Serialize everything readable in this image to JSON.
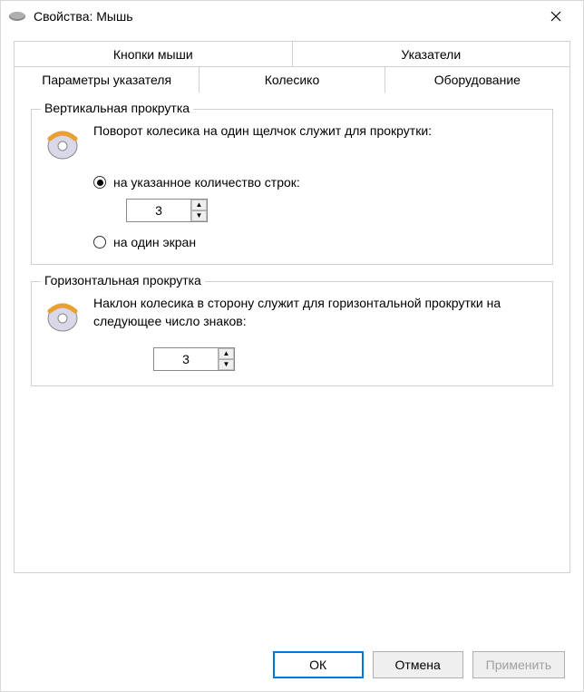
{
  "titlebar": {
    "title": "Свойства: Мышь"
  },
  "tabs": {
    "row1": [
      {
        "label": "Кнопки мыши"
      },
      {
        "label": "Указатели"
      }
    ],
    "row2": [
      {
        "label": "Параметры указателя"
      },
      {
        "label": "Колесико",
        "active": true
      },
      {
        "label": "Оборудование"
      }
    ]
  },
  "vertical_group": {
    "title": "Вертикальная прокрутка",
    "description": "Поворот колесика на один щелчок служит для прокрутки:",
    "radio_lines": "на указанное количество строк:",
    "lines_value": "3",
    "radio_screen": "на один экран"
  },
  "horizontal_group": {
    "title": "Горизонтальная прокрутка",
    "description": "Наклон колесика в сторону служит для горизонтальной прокрутки на следующее число знаков:",
    "chars_value": "3"
  },
  "buttons": {
    "ok": "ОК",
    "cancel": "Отмена",
    "apply": "Применить"
  }
}
